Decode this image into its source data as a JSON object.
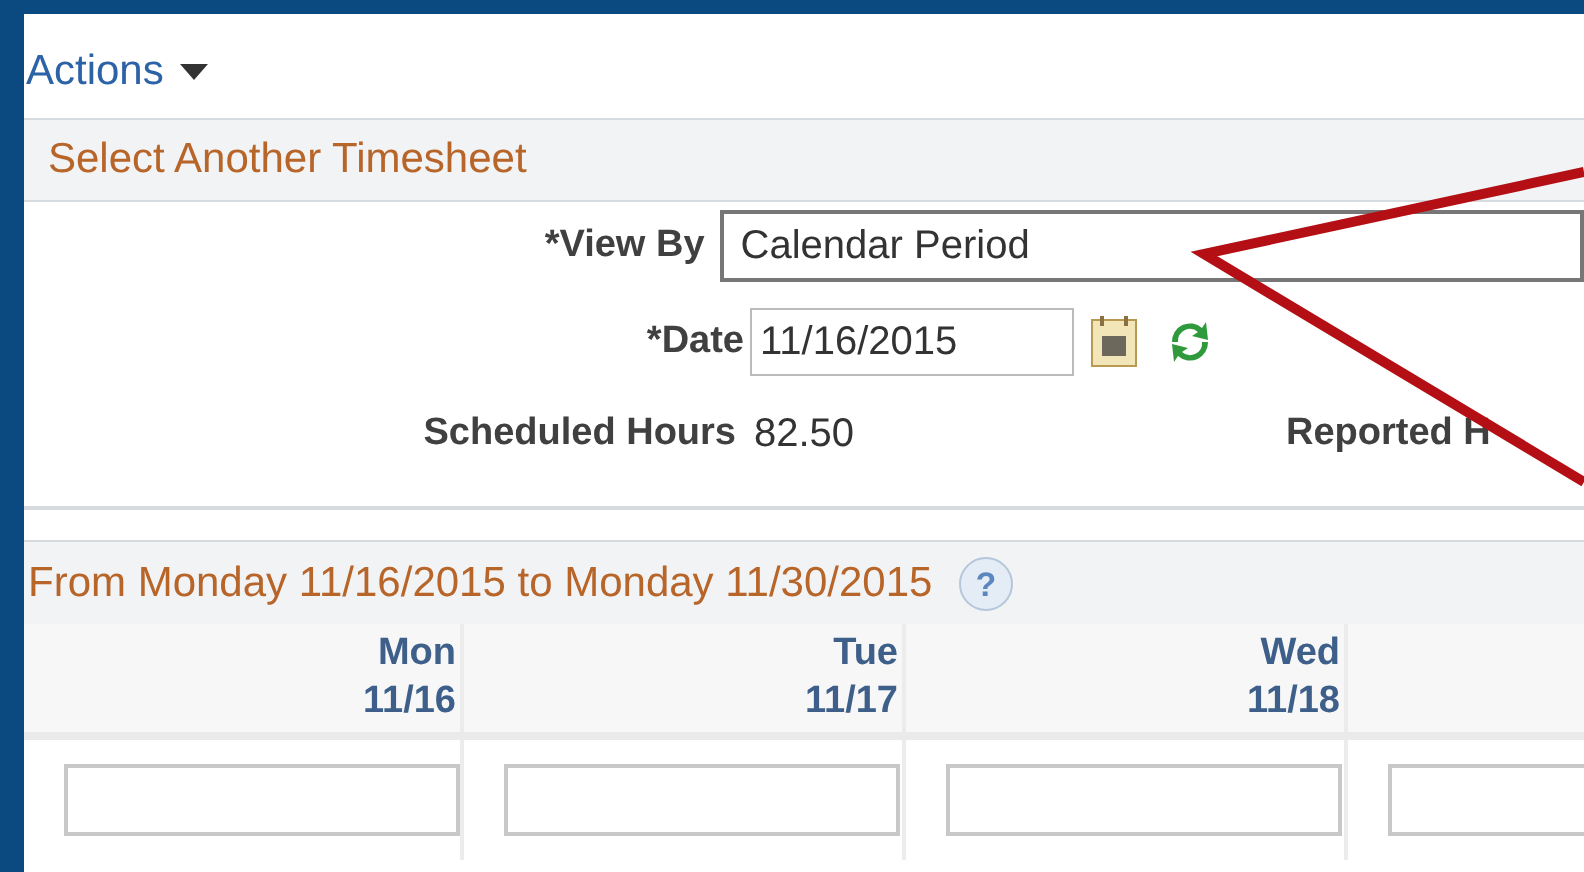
{
  "actions_menu": {
    "label": "Actions"
  },
  "select_section": {
    "title": "Select Another Timesheet",
    "view_by": {
      "label": "*View By",
      "value": "Calendar Period"
    },
    "date": {
      "label": "*Date",
      "value": "11/16/2015"
    },
    "scheduled_hours": {
      "label": "Scheduled Hours",
      "value": "82.50"
    },
    "reported_hours": {
      "label": "Reported H"
    }
  },
  "period_section": {
    "title": "From Monday 11/16/2015 to Monday 11/30/2015",
    "columns": [
      {
        "day": "Mon",
        "date": "11/16"
      },
      {
        "day": "Tue",
        "date": "11/17"
      },
      {
        "day": "Wed",
        "date": "11/18"
      },
      {}
    ],
    "help_symbol": "?"
  }
}
